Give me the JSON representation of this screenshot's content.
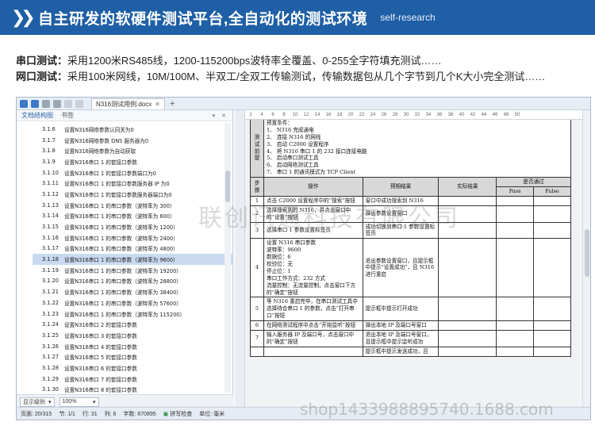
{
  "banner": {
    "icon": "double-chevron-icon",
    "title": "自主研发的软硬件测试平台,全自动化的测试环境",
    "subtitle": "self-research",
    "bg_color": "#1f5fa6"
  },
  "descriptions": [
    {
      "label": "串口测试：",
      "text": "采用1200米RS485线，1200-115200bps波特率全覆盖、0-255全字符填充测试……"
    },
    {
      "label": "网口测试：",
      "text": "采用100米网线，10M/100M、半双工/全双工传输测试，传输数据包从几个字节到几个K大小完全测试……"
    }
  ],
  "app": {
    "doc_tab": "N316测试用例.docx",
    "left_tabs": [
      "文档结构图",
      "书签"
    ],
    "outline": [
      {
        "num": "3.1.6",
        "text": "设置N316网络参数认同关为0"
      },
      {
        "num": "3.1.7",
        "text": "设置N316网络参数 DNS 服务器为0"
      },
      {
        "num": "3.1.8",
        "text": "设置N316网络参数为自动获取"
      },
      {
        "num": "3.1.9",
        "text": "设置N316串口 1 的套接口参数"
      },
      {
        "num": "3.1.10",
        "text": "设置N316串口 1 的套接口参数端口为0"
      },
      {
        "num": "3.1.11",
        "text": "设置N316串口 1 的套接口参数服务器 IP 为0"
      },
      {
        "num": "3.1.12",
        "text": "设置N316串口 1 的套接口参数服务器端口为0"
      },
      {
        "num": "3.1.13",
        "text": "设置N316串口 1 的串口参数（波特率为 300）"
      },
      {
        "num": "3.1.14",
        "text": "设置N316串口 1 的串口参数（波特率为 600）"
      },
      {
        "num": "3.1.15",
        "text": "设置N316串口 1 的串口参数（波特率为 1200）"
      },
      {
        "num": "3.1.16",
        "text": "设置N316串口 1 的串口参数（波特率为 2400）"
      },
      {
        "num": "3.1.17",
        "text": "设置N316串口 1 的串口参数（波特率为 4800）"
      },
      {
        "num": "3.1.18",
        "text": "设置N316串口 1 的串口参数（波特率为 9600）"
      },
      {
        "num": "3.1.19",
        "text": "设置N316串口 1 的串口参数（波特率为 19200）"
      },
      {
        "num": "3.1.20",
        "text": "设置N316串口 1 的串口参数（波特率为 28800）"
      },
      {
        "num": "3.1.21",
        "text": "设置N316串口 1 的串口参数（波特率为 38400）"
      },
      {
        "num": "3.1.22",
        "text": "设置N316串口 1 的串口参数（波特率为 57600）"
      },
      {
        "num": "3.1.23",
        "text": "设置N316串口 1 的串口参数（波特率为 115200）"
      },
      {
        "num": "3.1.24",
        "text": "设置N316串口 2 的套接口参数"
      },
      {
        "num": "3.1.25",
        "text": "设置N316串口 3 的套接口参数"
      },
      {
        "num": "3.1.26",
        "text": "设置N316串口 4 的套接口参数"
      },
      {
        "num": "3.1.27",
        "text": "设置N316串口 5 的套接口参数"
      },
      {
        "num": "3.1.28",
        "text": "设置N316串口 6 的套接口参数"
      },
      {
        "num": "3.1.29",
        "text": "设置N316串口 7 的套接口参数"
      },
      {
        "num": "3.1.30",
        "text": "设置N316串口 8 的套接口参数"
      }
    ],
    "selected_outline_index": 12,
    "bottom_controls": {
      "level_label": "显示级别",
      "zoom": "100%"
    },
    "ruler_ticks": [
      "2",
      "4",
      "6",
      "8",
      "10",
      "12",
      "14",
      "16",
      "18",
      "20",
      "22",
      "24",
      "26",
      "28",
      "30",
      "32",
      "34",
      "36",
      "38",
      "40",
      "42",
      "44",
      "46",
      "48",
      "50"
    ],
    "precondition": {
      "label": "测试前提",
      "lines": [
        "预置条件：",
        "1、 N316 完成通电",
        "2、 连接 N316 的网线",
        "3、 启动 C2000 设置程序",
        "4、 将 N316 串口 1 的 232 接口连接电脑",
        "5、 启动串口测试工具",
        "6、 启动网络测试工具",
        "7、 串口 1 的通讯模式为 TCP Client"
      ]
    },
    "table_headers": {
      "step": "步骤",
      "op": "操作",
      "expected": "预期结果",
      "actual": "实际结果",
      "pass_group": "是否通过",
      "pass": "Pass",
      "fail": "False"
    },
    "steps": [
      {
        "no": "1",
        "op": "点击 C2000 设置程序中的“搜索”按钮",
        "expected": "窗口中成功搜索到 N316"
      },
      {
        "no": "2",
        "op": "选择搜索到的 N316，并点击窗口中的“设置”按钮",
        "expected": "弹出参数设置窗口"
      },
      {
        "no": "3",
        "op": "选择串口 1 参数设置标签页",
        "expected": "成功切换到串口 1 参数设置标签页"
      },
      {
        "no": "4",
        "op_lines": [
          "设置 N316 串口参数",
          "波特率：9600",
          "数据位：6",
          "校验位：无",
          "停止位：1",
          "串口工作方式：232 方式",
          "流量控制：无流量控制，点击窗口下方的“确定”按钮"
        ],
        "expected": "退出参数设置窗口，且提示框中提示“设置成功”，且 N316 进行重启"
      },
      {
        "no": "5",
        "op": "等 N316 重启完毕，在串口测试工具中选择待合串口 1 的参数，点击“打开串口”按钮",
        "expected": "提示框中提示打开成功"
      },
      {
        "no": "6",
        "op": "在网络测试程序中点击“开始监听”按钮",
        "expected": "弹出本地 IP 及端口号窗口"
      },
      {
        "no": "7",
        "op": "输入服务器 IP 及端口号，点击窗口中的“确定”按钮",
        "expected": "退出本地 IP 及端口号窗口，且提示框中提示监听成功"
      },
      {
        "no": "",
        "op": "",
        "expected": "提示框中提示发送成功，且"
      }
    ],
    "status": {
      "page": "页面: 20/315",
      "section": "节: 1/1",
      "row": "行: 31",
      "col": "列: 6",
      "words": "字数: 870895",
      "spell": "拼写检查",
      "unit": "单位: 毫米"
    }
  },
  "watermarks": {
    "center": "联创讯通科技有限公司",
    "bottom": "shop1433988895740.1688.com"
  }
}
